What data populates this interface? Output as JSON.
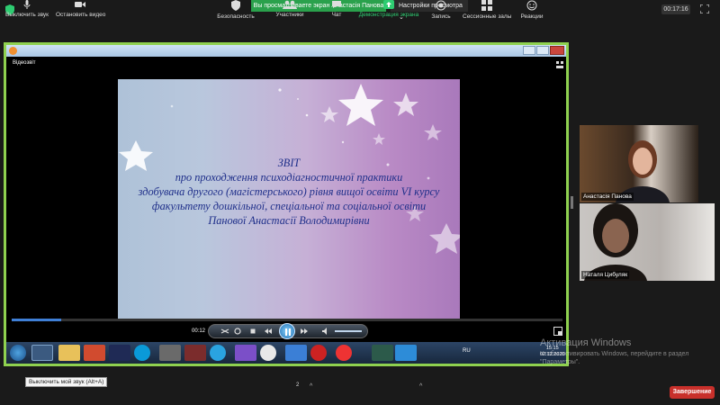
{
  "top_bar": {
    "share_banner": "Вы просматриваете экран Анастасія Панова",
    "view_options": "Настройки просмотра",
    "timer": "00:17:16"
  },
  "player": {
    "video_label": "Відеозвіт",
    "elapsed": "00:12",
    "progress_fraction": 0.09
  },
  "slide": {
    "lines": [
      "ЗВІТ",
      "про проходження психодіагностичної практики",
      "здобувача другого (магістерського) рівня вищої освіти VI  курсу",
      "факультету дошкільної, спеціальної та соціальної освіти",
      "Панової Анастасії Володимирівни"
    ]
  },
  "taskbar": {
    "language": "RU",
    "clock_time": "15:15",
    "clock_date": "02.12.2020"
  },
  "participants": [
    {
      "name": "Анастасія Панова"
    },
    {
      "name": "Наталя Цибуляк"
    }
  ],
  "watermark": {
    "title": "Активация Windows",
    "text_line1": "Чтобы активировать Windows, перейдите в раздел",
    "text_line2": "\"Параметры\"."
  },
  "tooltip": "Выключить мой звук (Alt+A)",
  "toolbar": {
    "mute": "Выключить звук",
    "stop_video": "Остановить видео",
    "security": "Безопасность",
    "participants": "Участники",
    "participants_count": "2",
    "chat": "Чат",
    "share_screen": "Демонстрация экрана",
    "record": "Запись",
    "breakout_rooms": "Сессионные залы",
    "reactions": "Реакции",
    "end": "Завершение"
  },
  "colors": {
    "share_green": "#2aa14c",
    "end_red": "#c8302b",
    "slide_text": "#1f2f8a",
    "frame_border": "#8fd14f"
  }
}
